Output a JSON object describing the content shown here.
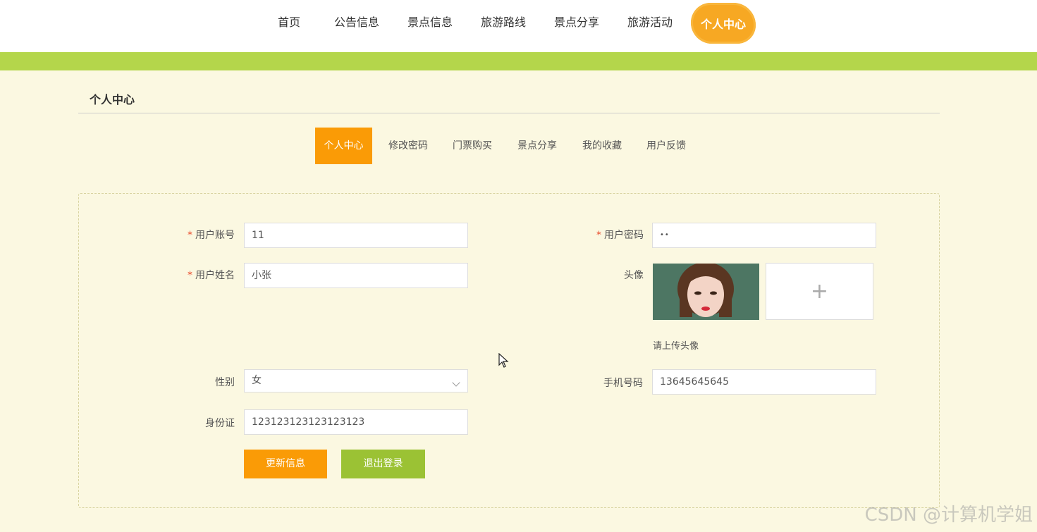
{
  "nav": {
    "items": [
      "首页",
      "公告信息",
      "景点信息",
      "旅游路线",
      "景点分享",
      "旅游活动"
    ],
    "active": "个人中心"
  },
  "section": {
    "title": "个人中心"
  },
  "subtabs": [
    "个人中心",
    "修改密码",
    "门票购买",
    "景点分享",
    "我的收藏",
    "用户反馈"
  ],
  "form": {
    "account": {
      "label": "用户账号",
      "value": "11"
    },
    "password": {
      "label": "用户密码",
      "value": "••"
    },
    "name": {
      "label": "用户姓名",
      "value": "小张"
    },
    "avatar": {
      "label": "头像",
      "hint": "请上传头像",
      "upload_icon": "+"
    },
    "gender": {
      "label": "性别",
      "value": "女"
    },
    "phone": {
      "label": "手机号码",
      "value": "13645645645"
    },
    "idcard": {
      "label": "身份证",
      "value": "123123123123123123"
    },
    "required_mark": "*"
  },
  "buttons": {
    "update": "更新信息",
    "logout": "退出登录"
  },
  "watermark": "CSDN @计算机学姐",
  "colors": {
    "accent": "#fa9b06",
    "green": "#b4d64b",
    "logout": "#9bc234"
  }
}
